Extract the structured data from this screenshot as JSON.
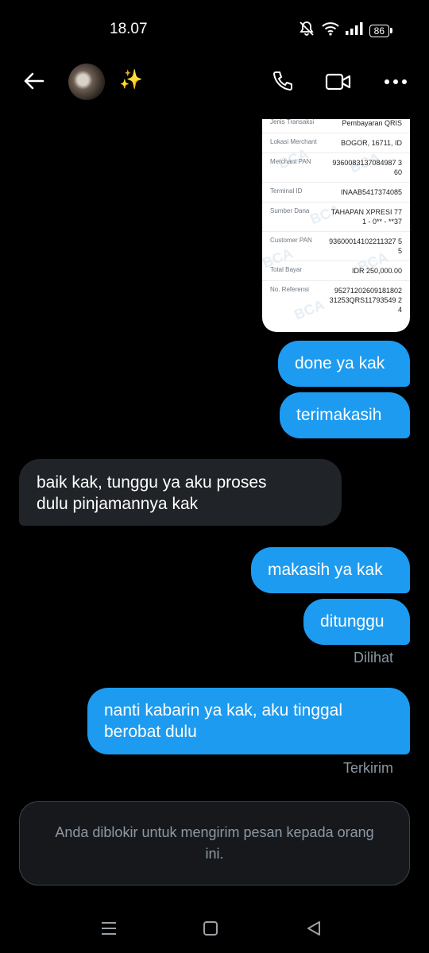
{
  "status_bar": {
    "time": "18.07",
    "battery": "86",
    "icons": [
      "mute-vibrate-icon",
      "wifi-icon",
      "signal-icon",
      "battery-icon"
    ]
  },
  "header": {
    "icons": [
      "back-arrow-icon",
      "avatar",
      "sparkle-emoji",
      "phone-icon",
      "video-icon",
      "more-icon"
    ],
    "name_emoji": "✨"
  },
  "receipt": {
    "rows": [
      {
        "label": "Jenis Transaksi",
        "value": "Pembayaran QRIS"
      },
      {
        "label": "Lokasi Merchant",
        "value": "BOGOR, 16711, ID"
      },
      {
        "label": "Merchant PAN",
        "value": "9360083137084987 360"
      },
      {
        "label": "Terminal ID",
        "value": "INAAB5417374085"
      },
      {
        "label": "Sumber Dana",
        "value": "TAHAPAN XPRESI 771 - 0** - **37"
      },
      {
        "label": "Customer PAN",
        "value": "93600014102211327 55"
      },
      {
        "label": "Total Bayar",
        "value": "IDR 250,000.00"
      },
      {
        "label": "No. Referensi",
        "value": "95271202609181802 31253QRS11793549 24"
      }
    ],
    "watermark": "BCA"
  },
  "messages": [
    {
      "dir": "out",
      "text": "done ya kak"
    },
    {
      "dir": "out",
      "text": "terimakasih"
    },
    {
      "dir": "in",
      "lines": [
        "baik kak, tunggu ya aku proses",
        "dulu pinjamannya kak"
      ]
    },
    {
      "dir": "out",
      "text": "makasih ya kak"
    },
    {
      "dir": "out",
      "text": "ditunggu"
    },
    {
      "dir": "out",
      "lines": [
        "nanti kabarin ya kak, aku tinggal",
        "berobat dulu"
      ]
    }
  ],
  "seen_label": "Dilihat",
  "sent_label": "Terkirim",
  "blocked_notice": "Anda diblokir untuk mengirim pesan kepada orang ini.",
  "colors": {
    "background": "#000000",
    "outgoing_bubble": "#1d9bf0",
    "incoming_bubble": "#202327",
    "meta_text": "#8b98a5"
  },
  "nav_bar": {
    "icons": [
      "recents-icon",
      "home-icon",
      "back-icon"
    ]
  }
}
